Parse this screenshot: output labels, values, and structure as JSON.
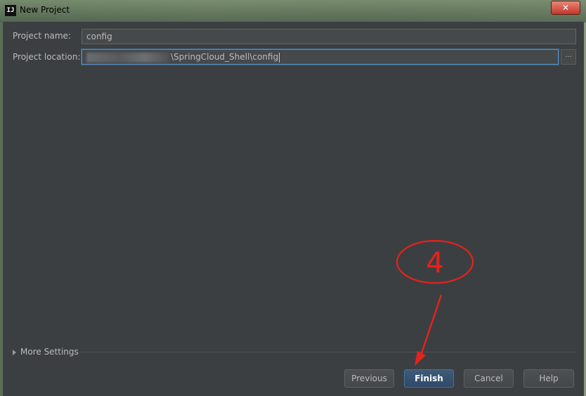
{
  "window": {
    "title": "New Project",
    "app_icon_text": "IJ",
    "close_glyph": "✕"
  },
  "form": {
    "project_name_label": "Project name:",
    "project_name_value": "config",
    "project_location_label": "Project location:",
    "project_location_value": "\\SpringCloud_Shell\\config",
    "browse_label": "..."
  },
  "more_settings": {
    "label": "More Settings"
  },
  "buttons": {
    "previous": "Previous",
    "finish": "Finish",
    "cancel": "Cancel",
    "help": "Help"
  },
  "annotation": {
    "number": "4",
    "color": "#e8211c"
  },
  "colors": {
    "dialog_bg": "#3c3f41",
    "field_bg": "#45494a",
    "focus_border": "#5e8fbf",
    "primary_button": "#2f4a68"
  }
}
